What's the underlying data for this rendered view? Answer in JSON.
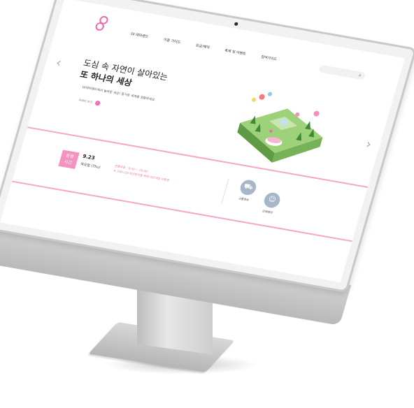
{
  "nav": {
    "items": [
      "DI 테마랜드",
      "이용 가이드",
      "요금/예약",
      "축제 및 이벤트",
      "참여가이드"
    ],
    "search_placeholder": ""
  },
  "hero": {
    "title_line1": "도심 속 자연이 살아있는",
    "title_line2": "또 하나의 세상",
    "subtitle": "DI테마랜드에서 놀라운 세상! 즐거운 세계를 경험하세요.",
    "more_label": "자세히 보기"
  },
  "hours": {
    "badge_line1": "운영",
    "badge_line2": "시간",
    "date": "9.23",
    "weekday": "목요일 (Thu)",
    "info_line1": "연중무휴 : 9:30 ~ 18:00",
    "info_line2": "※ 코로나19 확산방지를 위해 야간개장 미운영"
  },
  "quick_links": [
    {
      "label": "교통정보",
      "icon": "bus-icon"
    },
    {
      "label": "단체예약",
      "icon": "group-icon"
    }
  ],
  "colors": {
    "accent": "#f06aa8",
    "accent_light": "#f6a5cb",
    "icon_circle": "#a7b7c8"
  }
}
